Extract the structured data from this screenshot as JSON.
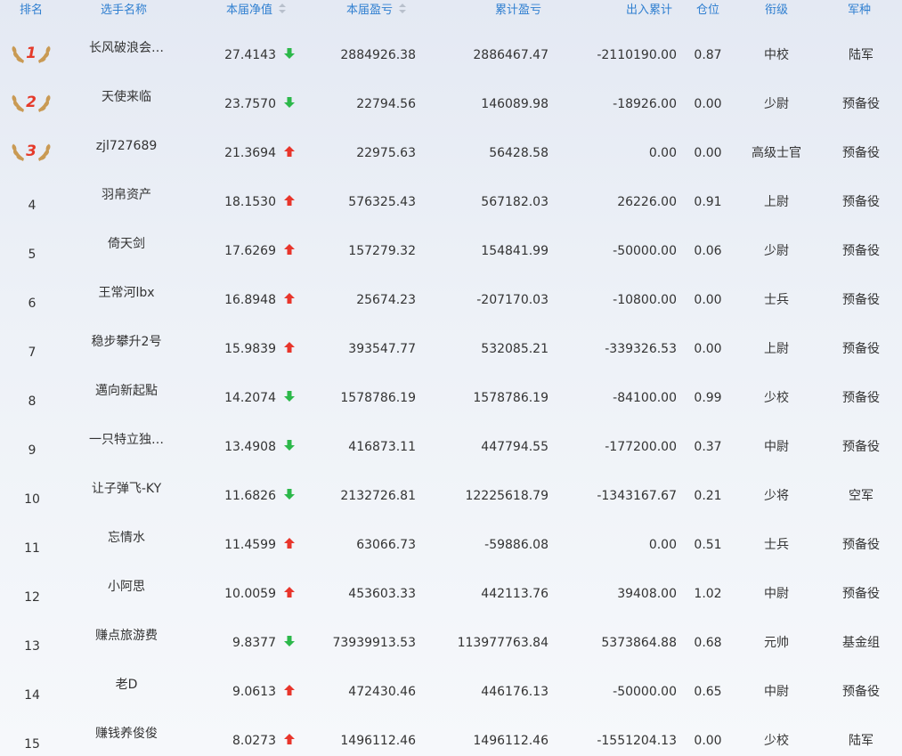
{
  "headers": {
    "rank": "排名",
    "name": "选手名称",
    "nav": "本届净值",
    "pnl": "本届盈亏",
    "cum_pnl": "累计盈亏",
    "io_total": "出入累计",
    "position": "仓位",
    "military_rank": "衔级",
    "corps": "军种"
  },
  "colors": {
    "header_text": "#2f7fd0",
    "up": "#e8352b",
    "down": "#2cb84a",
    "laurel": "#c99a54",
    "medal_num": "#e53a2a"
  },
  "rows": [
    {
      "rank": "1",
      "name": "长风破浪会…",
      "nav": "27.4143",
      "trend": "down",
      "pnl": "2884926.38",
      "cum": "2886467.47",
      "io": "-2110190.00",
      "pos": "0.87",
      "mil": "中校",
      "corps": "陆军"
    },
    {
      "rank": "2",
      "name": "天使来临",
      "nav": "23.7570",
      "trend": "down",
      "pnl": "22794.56",
      "cum": "146089.98",
      "io": "-18926.00",
      "pos": "0.00",
      "mil": "少尉",
      "corps": "预备役"
    },
    {
      "rank": "3",
      "name": "zjl727689",
      "nav": "21.3694",
      "trend": "up",
      "pnl": "22975.63",
      "cum": "56428.58",
      "io": "0.00",
      "pos": "0.00",
      "mil": "高级士官",
      "corps": "预备役"
    },
    {
      "rank": "4",
      "name": "羽帛资产",
      "nav": "18.1530",
      "trend": "up",
      "pnl": "576325.43",
      "cum": "567182.03",
      "io": "26226.00",
      "pos": "0.91",
      "mil": "上尉",
      "corps": "预备役"
    },
    {
      "rank": "5",
      "name": "倚天剑",
      "nav": "17.6269",
      "trend": "up",
      "pnl": "157279.32",
      "cum": "154841.99",
      "io": "-50000.00",
      "pos": "0.06",
      "mil": "少尉",
      "corps": "预备役"
    },
    {
      "rank": "6",
      "name": "王常河lbx",
      "nav": "16.8948",
      "trend": "up",
      "pnl": "25674.23",
      "cum": "-207170.03",
      "io": "-10800.00",
      "pos": "0.00",
      "mil": "士兵",
      "corps": "预备役"
    },
    {
      "rank": "7",
      "name": "稳步攀升2号",
      "nav": "15.9839",
      "trend": "up",
      "pnl": "393547.77",
      "cum": "532085.21",
      "io": "-339326.53",
      "pos": "0.00",
      "mil": "上尉",
      "corps": "预备役"
    },
    {
      "rank": "8",
      "name": "邁向新起點",
      "nav": "14.2074",
      "trend": "down",
      "pnl": "1578786.19",
      "cum": "1578786.19",
      "io": "-84100.00",
      "pos": "0.99",
      "mil": "少校",
      "corps": "预备役"
    },
    {
      "rank": "9",
      "name": "一只特立独…",
      "nav": "13.4908",
      "trend": "down",
      "pnl": "416873.11",
      "cum": "447794.55",
      "io": "-177200.00",
      "pos": "0.37",
      "mil": "中尉",
      "corps": "预备役"
    },
    {
      "rank": "10",
      "name": "让子弹飞-KY",
      "nav": "11.6826",
      "trend": "down",
      "pnl": "2132726.81",
      "cum": "12225618.79",
      "io": "-1343167.67",
      "pos": "0.21",
      "mil": "少将",
      "corps": "空军"
    },
    {
      "rank": "11",
      "name": "忘情水",
      "nav": "11.4599",
      "trend": "up",
      "pnl": "63066.73",
      "cum": "-59886.08",
      "io": "0.00",
      "pos": "0.51",
      "mil": "士兵",
      "corps": "预备役"
    },
    {
      "rank": "12",
      "name": "小阿思",
      "nav": "10.0059",
      "trend": "up",
      "pnl": "453603.33",
      "cum": "442113.76",
      "io": "39408.00",
      "pos": "1.02",
      "mil": "中尉",
      "corps": "预备役"
    },
    {
      "rank": "13",
      "name": "赚点旅游费",
      "nav": "9.8377",
      "trend": "down",
      "pnl": "73939913.53",
      "cum": "113977763.84",
      "io": "5373864.88",
      "pos": "0.68",
      "mil": "元帅",
      "corps": "基金组"
    },
    {
      "rank": "14",
      "name": "老D",
      "nav": "9.0613",
      "trend": "up",
      "pnl": "472430.46",
      "cum": "446176.13",
      "io": "-50000.00",
      "pos": "0.65",
      "mil": "中尉",
      "corps": "预备役"
    },
    {
      "rank": "15",
      "name": "赚钱养俊俊",
      "nav": "8.0273",
      "trend": "up",
      "pnl": "1496112.46",
      "cum": "1496112.46",
      "io": "-1551204.13",
      "pos": "0.00",
      "mil": "少校",
      "corps": "陆军"
    }
  ]
}
